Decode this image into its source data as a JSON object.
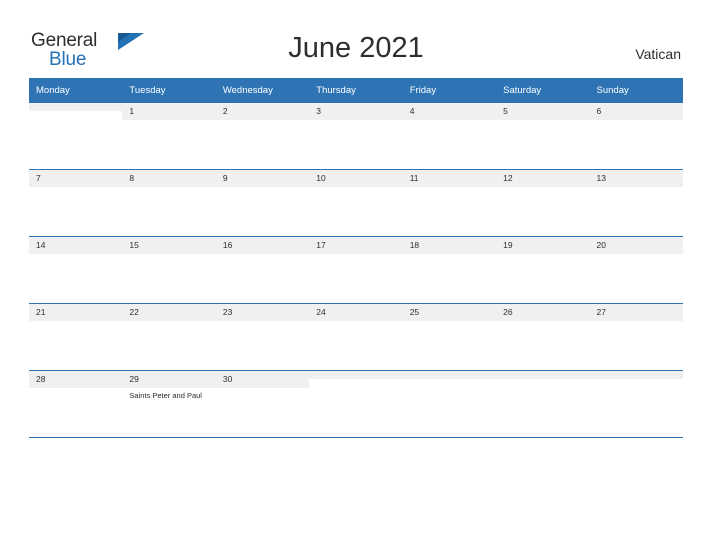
{
  "brand": {
    "word_general": "General",
    "word_blue": "Blue",
    "flag_icon": "flag-icon"
  },
  "header": {
    "title": "June 2021",
    "country": "Vatican"
  },
  "calendar": {
    "weekday_headers": [
      "Monday",
      "Tuesday",
      "Wednesday",
      "Thursday",
      "Friday",
      "Saturday",
      "Sunday"
    ],
    "accent_color": "#2e74b5",
    "daycell_color": "#f0f0f0",
    "weeks": [
      [
        {
          "day": "",
          "event": ""
        },
        {
          "day": "1",
          "event": ""
        },
        {
          "day": "2",
          "event": ""
        },
        {
          "day": "3",
          "event": ""
        },
        {
          "day": "4",
          "event": ""
        },
        {
          "day": "5",
          "event": ""
        },
        {
          "day": "6",
          "event": ""
        }
      ],
      [
        {
          "day": "7",
          "event": ""
        },
        {
          "day": "8",
          "event": ""
        },
        {
          "day": "9",
          "event": ""
        },
        {
          "day": "10",
          "event": ""
        },
        {
          "day": "11",
          "event": ""
        },
        {
          "day": "12",
          "event": ""
        },
        {
          "day": "13",
          "event": ""
        }
      ],
      [
        {
          "day": "14",
          "event": ""
        },
        {
          "day": "15",
          "event": ""
        },
        {
          "day": "16",
          "event": ""
        },
        {
          "day": "17",
          "event": ""
        },
        {
          "day": "18",
          "event": ""
        },
        {
          "day": "19",
          "event": ""
        },
        {
          "day": "20",
          "event": ""
        }
      ],
      [
        {
          "day": "21",
          "event": ""
        },
        {
          "day": "22",
          "event": ""
        },
        {
          "day": "23",
          "event": ""
        },
        {
          "day": "24",
          "event": ""
        },
        {
          "day": "25",
          "event": ""
        },
        {
          "day": "26",
          "event": ""
        },
        {
          "day": "27",
          "event": ""
        }
      ],
      [
        {
          "day": "28",
          "event": ""
        },
        {
          "day": "29",
          "event": "Saints Peter and Paul"
        },
        {
          "day": "30",
          "event": ""
        },
        {
          "day": "",
          "event": ""
        },
        {
          "day": "",
          "event": ""
        },
        {
          "day": "",
          "event": ""
        },
        {
          "day": "",
          "event": ""
        }
      ]
    ]
  }
}
